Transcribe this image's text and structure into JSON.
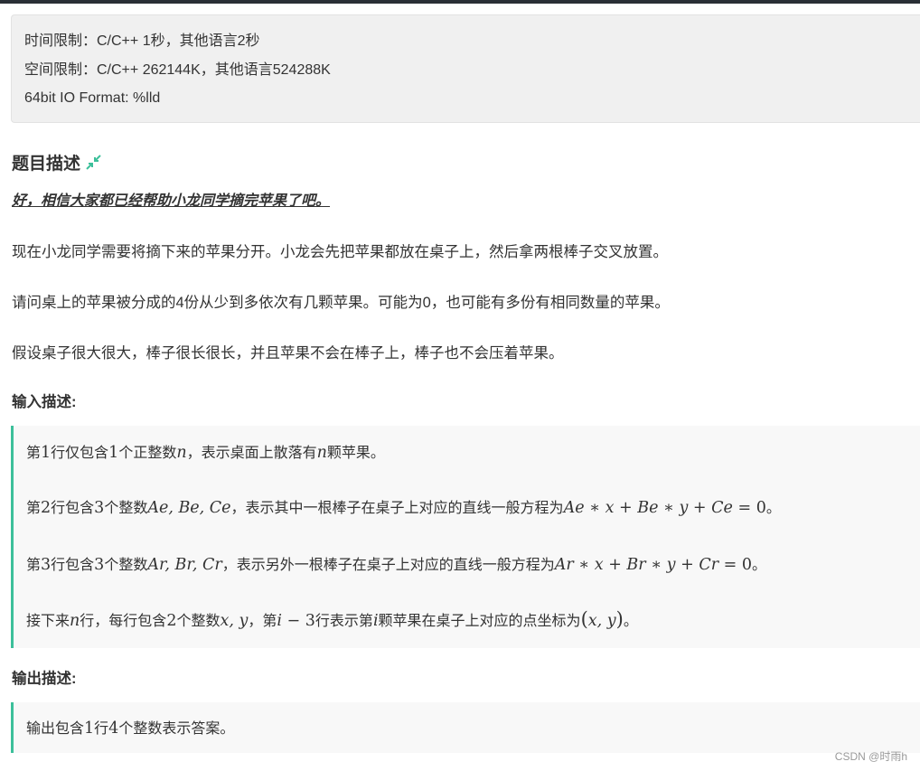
{
  "limits": {
    "time": "时间限制：C/C++ 1秒，其他语言2秒",
    "space": "空间限制：C/C++ 262144K，其他语言524288K",
    "format": "64bit IO Format: %lld"
  },
  "description": {
    "title": "题目描述",
    "title_icon": "shrink-arrows-icon",
    "emphasis": "好，相信大家都已经帮助小龙同学摘完苹果了吧。",
    "paragraphs": [
      "现在小龙同学需要将摘下来的苹果分开。小龙会先把苹果都放在桌子上，然后拿两根棒子交叉放置。",
      "请问桌上的苹果被分成的4份从少到多依次有几颗苹果。可能为0，也可能有多份有相同数量的苹果。",
      "假设桌子很大很大，棒子很长很长，并且苹果不会在棒子上，棒子也不会压着苹果。"
    ]
  },
  "input": {
    "title": "输入描述:",
    "l1": {
      "a": "第",
      "n1": "1",
      "b": "行仅包含",
      "n2": "1",
      "c": "个正整数",
      "v": "n",
      "d": "，表示桌面上散落有",
      "v2": "n",
      "e": "颗苹果。"
    },
    "l2": {
      "a": "第",
      "n1": "2",
      "b": "行包含",
      "n2": "3",
      "c": "个整数",
      "vars": "Ae, Be, Ce",
      "d": "，表示其中一根棒子在桌子上对应的直线一般方程为",
      "eq_lhs": "Ae ∗ x + Be ∗ y + Ce",
      "eq_op": " = ",
      "eq_rhs": "0",
      "e": "。"
    },
    "l3": {
      "a": "第",
      "n1": "3",
      "b": "行包含",
      "n2": "3",
      "c": "个整数",
      "vars": "Ar, Br, Cr",
      "d": "，表示另外一根棒子在桌子上对应的直线一般方程为",
      "eq_lhs": "Ar ∗ x + Br ∗ y + Cr",
      "eq_op": " = ",
      "eq_rhs": "0",
      "e": "。"
    },
    "l4": {
      "a": "接下来",
      "v": "n",
      "b": "行，每行包含",
      "n1": "2",
      "c": "个整数",
      "vars": "x, y",
      "d": "，第",
      "expr_v": "i",
      "expr_op": " − ",
      "expr_n": "3",
      "e": "行表示第",
      "v2": "i",
      "f": "颗苹果在桌子上对应的点坐标为",
      "lp": "(",
      "pt": "x, y",
      "rp": ")",
      "g": "。"
    }
  },
  "output": {
    "title": "输出描述:",
    "l1": {
      "a": "输出包含",
      "n1": "1",
      "b": "行",
      "n2": "4",
      "c": "个整数表示答案。"
    }
  },
  "watermark": "CSDN @时雨h",
  "colors": {
    "accent": "#3cbf9a",
    "panel": "#f0f0f0",
    "block": "#f8f8f8",
    "text": "#333333"
  }
}
